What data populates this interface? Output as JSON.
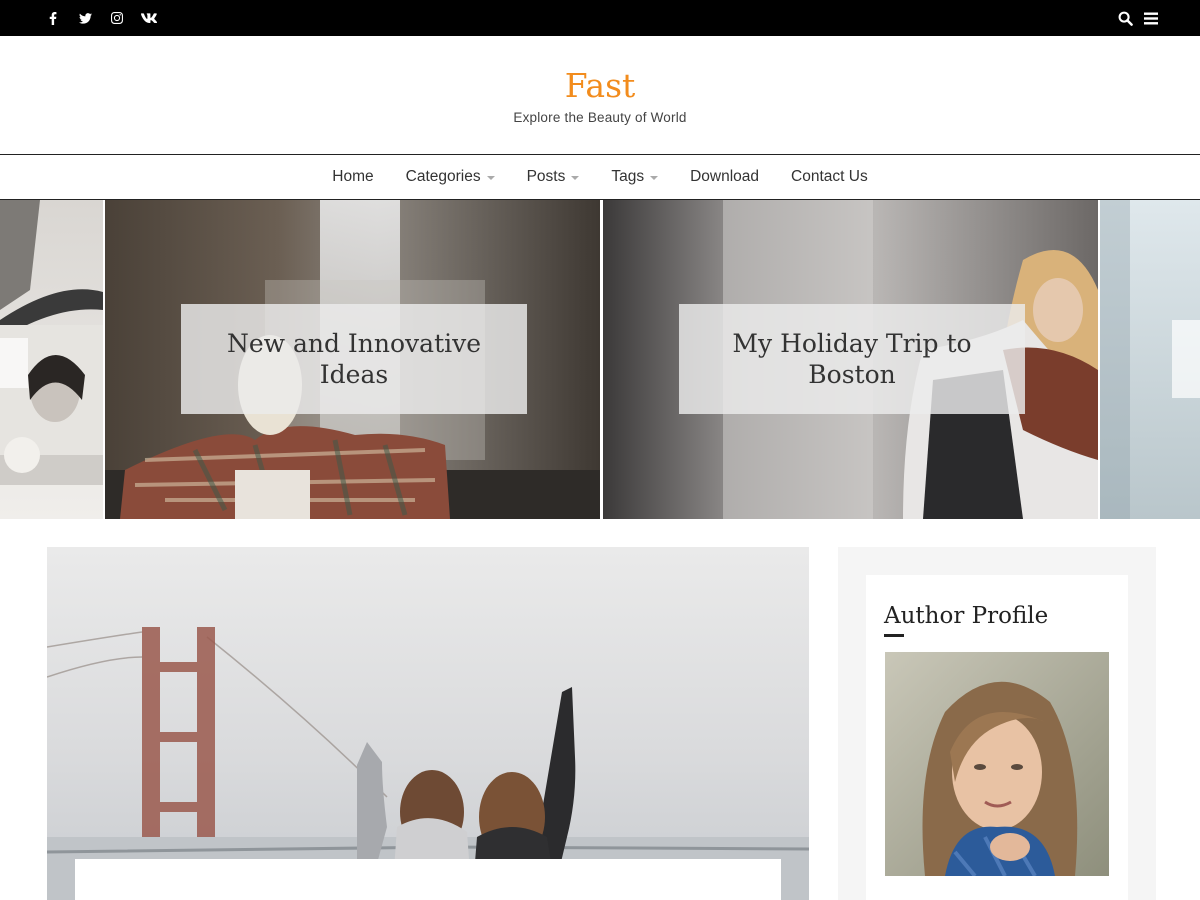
{
  "topbar": {
    "social_icons": [
      "facebook-icon",
      "twitter-icon",
      "instagram-icon",
      "vk-icon"
    ],
    "right_icons": [
      "search-icon",
      "menu-icon"
    ]
  },
  "site": {
    "title": "Fast",
    "description": "Explore the Beauty of World",
    "title_color": "#f28c1d"
  },
  "nav": {
    "items": [
      {
        "label": "Home",
        "has_dropdown": false
      },
      {
        "label": "Categories",
        "has_dropdown": true
      },
      {
        "label": "Posts",
        "has_dropdown": true
      },
      {
        "label": "Tags",
        "has_dropdown": true
      },
      {
        "label": "Download",
        "has_dropdown": false
      },
      {
        "label": "Contact Us",
        "has_dropdown": false
      }
    ]
  },
  "slider": {
    "slides": [
      {
        "caption": "New and Innovative Ideas"
      },
      {
        "caption": "My Holiday Trip to Boston"
      }
    ]
  },
  "sidebar": {
    "widget_title": "Author Profile"
  }
}
